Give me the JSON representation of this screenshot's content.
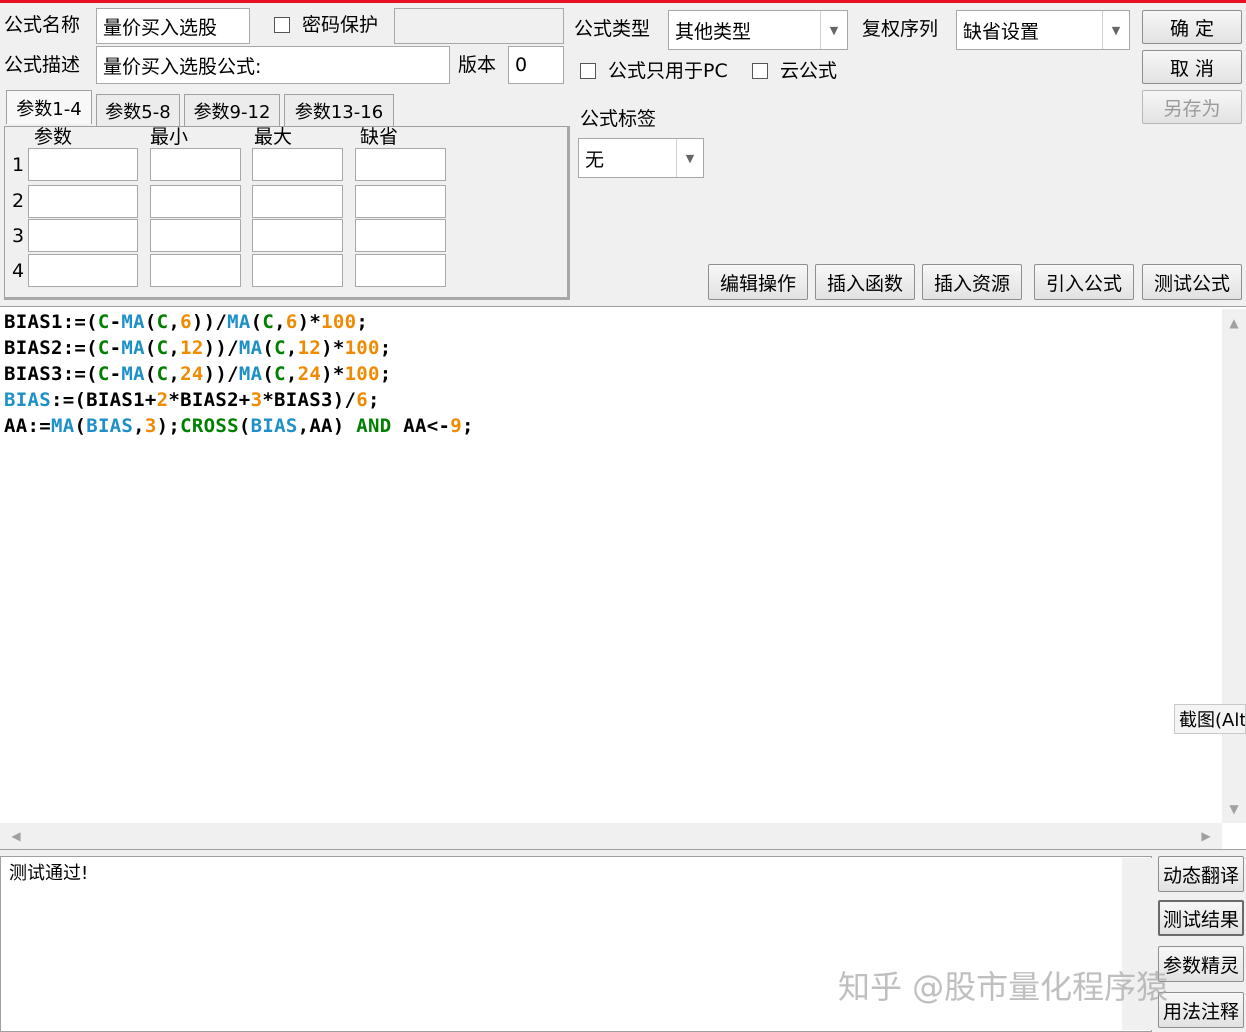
{
  "header": {
    "name_label": "公式名称",
    "name_value": "量价买入选股",
    "password_label": "密码保护",
    "desc_label": "公式描述",
    "desc_value": "量价买入选股公式:",
    "version_label": "版本",
    "version_value": "0",
    "type_label": "公式类型",
    "type_value": "其他类型",
    "rights_label": "复权序列",
    "rights_value": "缺省设置",
    "pc_only_label": "公式只用于PC",
    "cloud_label": "云公式",
    "tag_label": "公式标签",
    "tag_value": "无"
  },
  "buttons": {
    "ok": "确  定",
    "cancel": "取  消",
    "save_as": "另存为",
    "edit_ops": "编辑操作",
    "insert_func": "插入函数",
    "insert_res": "插入资源",
    "import_formula": "引入公式",
    "test_formula": "测试公式",
    "dyn_translate": "动态翻译",
    "test_result": "测试结果",
    "param_wizard": "参数精灵",
    "usage_notes": "用法注释"
  },
  "params": {
    "tabs": [
      "参数1-4",
      "参数5-8",
      "参数9-12",
      "参数13-16"
    ],
    "columns": [
      "参数",
      "最小",
      "最大",
      "缺省"
    ],
    "rows": [
      "1",
      "2",
      "3",
      "4"
    ]
  },
  "editor": {
    "lines": [
      "BIAS1:=(C-MA(C,6))/MA(C,6)*100;",
      "BIAS2:=(C-MA(C,12))/MA(C,12)*100;",
      "BIAS3:=(C-MA(C,24))/MA(C,24)*100;",
      "BIAS:=(BIAS1+2*BIAS2+3*BIAS3)/6;",
      "AA:=MA(BIAS,3);CROSS(BIAS,AA) AND AA<-9;"
    ]
  },
  "output": {
    "text": "测试通过!"
  },
  "screenshot_hint": "截图(Alt",
  "watermark": "知乎 @股市量化程序猿",
  "colors": {
    "accent_red": "#e81123",
    "code_green": "#008000",
    "code_blue": "#1e90c8",
    "code_orange": "#f08a00"
  }
}
